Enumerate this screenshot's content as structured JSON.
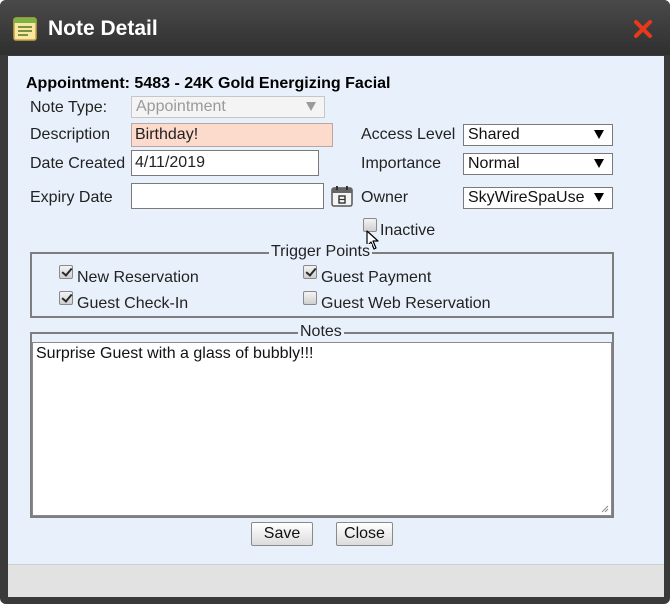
{
  "window": {
    "title": "Note Detail"
  },
  "appointment": {
    "title": "Appointment: 5483 - 24K Gold Energizing Facial"
  },
  "form": {
    "note_type_label": "Note Type:",
    "note_type_value": "Appointment",
    "description_label": "Description",
    "description_value": "Birthday!",
    "date_created_label": "Date Created",
    "date_created_value": "4/11/2019",
    "expiry_date_label": "Expiry Date",
    "expiry_date_value": "",
    "access_level_label": "Access Level",
    "access_level_value": "Shared",
    "importance_label": "Importance",
    "importance_value": "Normal",
    "owner_label": "Owner",
    "owner_value": "SkyWireSpaUse",
    "inactive_label": "Inactive",
    "inactive_checked": false
  },
  "trigger_points": {
    "legend": "Trigger Points",
    "items": [
      {
        "label": "New Reservation",
        "checked": true
      },
      {
        "label": "Guest Payment",
        "checked": true
      },
      {
        "label": "Guest Check-In",
        "checked": true
      },
      {
        "label": "Guest Web Reservation",
        "checked": false
      }
    ]
  },
  "notes": {
    "legend": "Notes",
    "text": "Surprise Guest with a glass of bubbly!!!"
  },
  "buttons": {
    "save_label": "Save",
    "close_label": "Close"
  },
  "colors": {
    "titlebar": "#3a3a3a",
    "body_bg": "#e8f1fb",
    "description_bg": "#fcdacc",
    "close_icon": "#e8391d"
  }
}
